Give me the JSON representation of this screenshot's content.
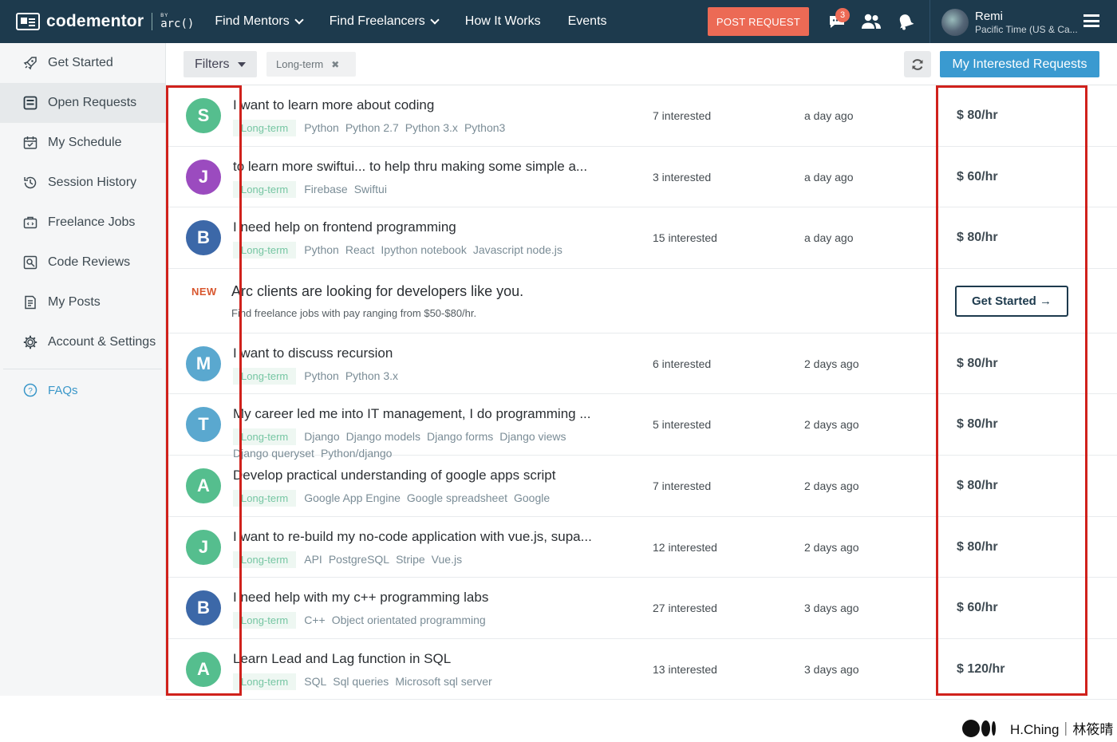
{
  "brand": {
    "name": "codementor",
    "by": "BY",
    "arc": "arc()"
  },
  "nav": [
    {
      "label": "Find Mentors",
      "dropdown": true
    },
    {
      "label": "Find Freelancers",
      "dropdown": true
    },
    {
      "label": "How It Works",
      "dropdown": false
    },
    {
      "label": "Events",
      "dropdown": false
    }
  ],
  "post_request": "POST REQUEST",
  "notifications": {
    "messages_count": "3"
  },
  "user": {
    "name": "Remi",
    "timezone": "Pacific Time (US & Ca..."
  },
  "sidebar": {
    "items": [
      {
        "label": "Get Started",
        "icon": "rocket-icon"
      },
      {
        "label": "Open Requests",
        "icon": "list-icon",
        "active": true
      },
      {
        "label": "My Schedule",
        "icon": "calendar-icon"
      },
      {
        "label": "Session History",
        "icon": "history-icon"
      },
      {
        "label": "Freelance Jobs",
        "icon": "briefcase-icon"
      },
      {
        "label": "Code Reviews",
        "icon": "code-review-icon"
      },
      {
        "label": "My Posts",
        "icon": "document-icon"
      },
      {
        "label": "Account & Settings",
        "icon": "gear-icon"
      }
    ],
    "faq": "FAQs"
  },
  "toolbar": {
    "filters": "Filters",
    "active_filter": "Long-term",
    "my_interested": "My Interested Requests"
  },
  "requests": [
    {
      "initial": "S",
      "color": "#55be8e",
      "title": "I want to learn more about coding",
      "tags": [
        "Python",
        "Python 2.7",
        "Python 3.x",
        "Python3"
      ],
      "interested": "7 interested",
      "ago": "a day ago",
      "rate": "$ 80/hr"
    },
    {
      "initial": "J",
      "color": "#9b4bbf",
      "title": "to learn more swiftui... to help thru making some simple a...",
      "tags": [
        "Firebase",
        "Swiftui"
      ],
      "interested": "3 interested",
      "ago": "a day ago",
      "rate": "$ 60/hr"
    },
    {
      "initial": "B",
      "color": "#3c68a8",
      "title": "I need help on frontend programming",
      "tags": [
        "Python",
        "React",
        "Ipython notebook",
        "Javascript node.js"
      ],
      "interested": "15 interested",
      "ago": "a day ago",
      "rate": "$ 80/hr"
    },
    {
      "initial": "M",
      "color": "#5aa8cf",
      "title": "I want to discuss recursion",
      "tags": [
        "Python",
        "Python 3.x"
      ],
      "interested": "6 interested",
      "ago": "2 days ago",
      "rate": "$ 80/hr"
    },
    {
      "initial": "T",
      "color": "#5aa8cf",
      "title": "My career led me into IT management, I do programming ...",
      "tags": [
        "Django",
        "Django models",
        "Django forms",
        "Django views",
        "Django queryset",
        "Python/django"
      ],
      "interested": "5 interested",
      "ago": "2 days ago",
      "rate": "$ 80/hr"
    },
    {
      "initial": "A",
      "color": "#55be8e",
      "title": "Develop practical understanding of google apps script",
      "tags": [
        "Google App Engine",
        "Google spreadsheet",
        "Google"
      ],
      "interested": "7 interested",
      "ago": "2 days ago",
      "rate": "$ 80/hr"
    },
    {
      "initial": "J",
      "color": "#55be8e",
      "title": "I want to re-build my no-code application with vue.js, supa...",
      "tags": [
        "API",
        "PostgreSQL",
        "Stripe",
        "Vue.js"
      ],
      "interested": "12 interested",
      "ago": "2 days ago",
      "rate": "$ 80/hr"
    },
    {
      "initial": "B",
      "color": "#3c68a8",
      "title": "I need help with my c++ programming labs",
      "tags": [
        "C++",
        "Object orientated programming"
      ],
      "interested": "27 interested",
      "ago": "3 days ago",
      "rate": "$ 60/hr"
    },
    {
      "initial": "A",
      "color": "#55be8e",
      "title": "Learn Lead and Lag function in SQL",
      "tags": [
        "SQL",
        "Sql queries",
        "Microsoft sql server"
      ],
      "interested": "13 interested",
      "ago": "3 days ago",
      "rate": "$ 120/hr"
    }
  ],
  "promo": {
    "badge": "NEW",
    "title": "Arc clients are looking for developers like you.",
    "subtitle": "Find freelance jobs with pay ranging from $50-$80/hr.",
    "cta": "Get Started →"
  },
  "tag_long_term": "Long-term",
  "footer_credit": "H.Ching｜林筱晴",
  "colors": {
    "nav_bg": "#1d3a4d",
    "accent_orange": "#ec6a55",
    "accent_blue": "#3a9ad0",
    "highlight": "#d0211c"
  }
}
